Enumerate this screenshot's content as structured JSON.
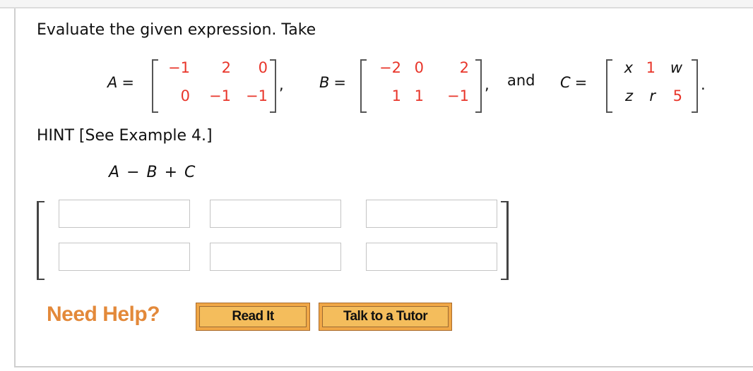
{
  "question": {
    "prompt": "Evaluate the given expression. Take",
    "matrices": [
      {
        "name": "A",
        "equals": "=",
        "rows": [
          [
            {
              "text": "−1",
              "kind": "num"
            },
            {
              "text": "2",
              "kind": "num"
            },
            {
              "text": "0",
              "kind": "num"
            }
          ],
          [
            {
              "text": "0",
              "kind": "num"
            },
            {
              "text": "−1",
              "kind": "num"
            },
            {
              "text": "−1",
              "kind": "num"
            }
          ]
        ],
        "trailing": ","
      },
      {
        "name": "B",
        "equals": "=",
        "rows": [
          [
            {
              "text": "−2",
              "kind": "num"
            },
            {
              "text": "0",
              "kind": "num"
            },
            {
              "text": "2",
              "kind": "num"
            }
          ],
          [
            {
              "text": "1",
              "kind": "num"
            },
            {
              "text": "1",
              "kind": "num"
            },
            {
              "text": "−1",
              "kind": "num"
            }
          ]
        ],
        "trailing": ","
      },
      {
        "name": "C",
        "equals": "=",
        "rows": [
          [
            {
              "text": "x",
              "kind": "var"
            },
            {
              "text": "1",
              "kind": "num"
            },
            {
              "text": "w",
              "kind": "var"
            }
          ],
          [
            {
              "text": "z",
              "kind": "var"
            },
            {
              "text": "r",
              "kind": "var"
            },
            {
              "text": "5",
              "kind": "num"
            }
          ]
        ],
        "trailing": "."
      }
    ],
    "connector": "and",
    "hint": "HINT [See Example 4.]",
    "expression": {
      "terms": [
        "A",
        "B",
        "C"
      ],
      "ops": [
        "−",
        "+"
      ]
    }
  },
  "answer": {
    "cells": [
      [
        "",
        "",
        ""
      ],
      [
        "",
        "",
        ""
      ]
    ]
  },
  "help": {
    "label": "Need Help?",
    "buttons": [
      "Read It",
      "Talk to a Tutor"
    ]
  },
  "colors": {
    "given_number": "#e8352a",
    "need_help": "#e3893a",
    "button_fill": "#f4bd5c"
  }
}
